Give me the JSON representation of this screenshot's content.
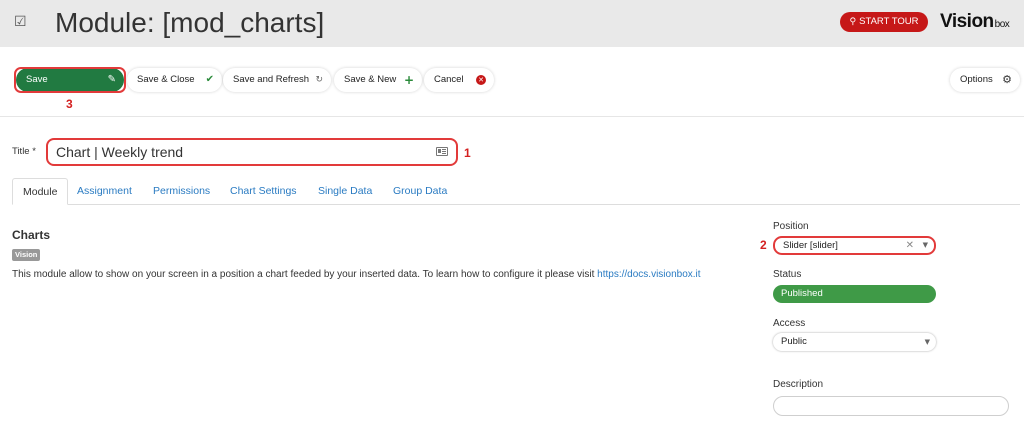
{
  "header": {
    "icon": "checkbox-icon",
    "title": "Module: [mod_charts]",
    "tour_label": "START TOUR",
    "logo_main": "Vision",
    "logo_sub": "box"
  },
  "toolbar": {
    "save_label": "Save",
    "save_close_label": "Save & Close",
    "save_refresh_label": "Save and Refresh",
    "save_new_label": "Save & New",
    "cancel_label": "Cancel",
    "options_label": "Options"
  },
  "annotations": {
    "one": "1",
    "two": "2",
    "three": "3"
  },
  "title_field": {
    "label": "Title",
    "required_mark": "*",
    "value": "Chart | Weekly trend"
  },
  "tabs": [
    {
      "label": "Module",
      "active": true
    },
    {
      "label": "Assignment"
    },
    {
      "label": "Permissions"
    },
    {
      "label": "Chart Settings"
    },
    {
      "label": "Single Data"
    },
    {
      "label": "Group Data"
    }
  ],
  "main": {
    "heading": "Charts",
    "badge": "Vision",
    "description": "This module allow to show on your screen in a position a chart feeded by your inserted data. To learn how to configure it please visit ",
    "link": "https://docs.visionbox.it"
  },
  "sidebar": {
    "position_label": "Position",
    "position_value": "Slider [slider]",
    "status_label": "Status",
    "status_value": "Published",
    "access_label": "Access",
    "access_value": "Public",
    "description_label": "Description"
  },
  "colors": {
    "save_green": "#217a41",
    "published_green": "#3f9a47",
    "tour_red": "#c61818",
    "highlight_red": "#e23a3a",
    "link_blue": "#2a7bc2"
  }
}
